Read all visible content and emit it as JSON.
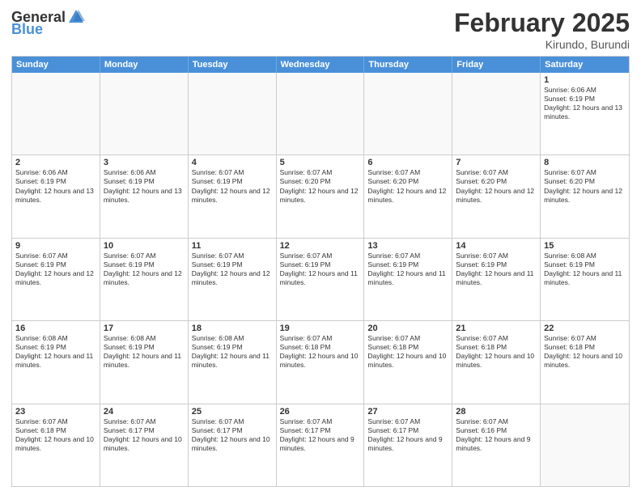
{
  "logo": {
    "general": "General",
    "blue": "Blue"
  },
  "title": {
    "month": "February 2025",
    "location": "Kirundo, Burundi"
  },
  "header": {
    "days": [
      "Sunday",
      "Monday",
      "Tuesday",
      "Wednesday",
      "Thursday",
      "Friday",
      "Saturday"
    ]
  },
  "weeks": [
    {
      "cells": [
        {
          "day": "",
          "info": "",
          "empty": true
        },
        {
          "day": "",
          "info": "",
          "empty": true
        },
        {
          "day": "",
          "info": "",
          "empty": true
        },
        {
          "day": "",
          "info": "",
          "empty": true
        },
        {
          "day": "",
          "info": "",
          "empty": true
        },
        {
          "day": "",
          "info": "",
          "empty": true
        },
        {
          "day": "1",
          "info": "Sunrise: 6:06 AM\nSunset: 6:19 PM\nDaylight: 12 hours and 13 minutes."
        }
      ]
    },
    {
      "cells": [
        {
          "day": "2",
          "info": "Sunrise: 6:06 AM\nSunset: 6:19 PM\nDaylight: 12 hours and 13 minutes."
        },
        {
          "day": "3",
          "info": "Sunrise: 6:06 AM\nSunset: 6:19 PM\nDaylight: 12 hours and 13 minutes."
        },
        {
          "day": "4",
          "info": "Sunrise: 6:07 AM\nSunset: 6:19 PM\nDaylight: 12 hours and 12 minutes."
        },
        {
          "day": "5",
          "info": "Sunrise: 6:07 AM\nSunset: 6:20 PM\nDaylight: 12 hours and 12 minutes."
        },
        {
          "day": "6",
          "info": "Sunrise: 6:07 AM\nSunset: 6:20 PM\nDaylight: 12 hours and 12 minutes."
        },
        {
          "day": "7",
          "info": "Sunrise: 6:07 AM\nSunset: 6:20 PM\nDaylight: 12 hours and 12 minutes."
        },
        {
          "day": "8",
          "info": "Sunrise: 6:07 AM\nSunset: 6:20 PM\nDaylight: 12 hours and 12 minutes."
        }
      ]
    },
    {
      "cells": [
        {
          "day": "9",
          "info": "Sunrise: 6:07 AM\nSunset: 6:19 PM\nDaylight: 12 hours and 12 minutes."
        },
        {
          "day": "10",
          "info": "Sunrise: 6:07 AM\nSunset: 6:19 PM\nDaylight: 12 hours and 12 minutes."
        },
        {
          "day": "11",
          "info": "Sunrise: 6:07 AM\nSunset: 6:19 PM\nDaylight: 12 hours and 12 minutes."
        },
        {
          "day": "12",
          "info": "Sunrise: 6:07 AM\nSunset: 6:19 PM\nDaylight: 12 hours and 11 minutes."
        },
        {
          "day": "13",
          "info": "Sunrise: 6:07 AM\nSunset: 6:19 PM\nDaylight: 12 hours and 11 minutes."
        },
        {
          "day": "14",
          "info": "Sunrise: 6:07 AM\nSunset: 6:19 PM\nDaylight: 12 hours and 11 minutes."
        },
        {
          "day": "15",
          "info": "Sunrise: 6:08 AM\nSunset: 6:19 PM\nDaylight: 12 hours and 11 minutes."
        }
      ]
    },
    {
      "cells": [
        {
          "day": "16",
          "info": "Sunrise: 6:08 AM\nSunset: 6:19 PM\nDaylight: 12 hours and 11 minutes."
        },
        {
          "day": "17",
          "info": "Sunrise: 6:08 AM\nSunset: 6:19 PM\nDaylight: 12 hours and 11 minutes."
        },
        {
          "day": "18",
          "info": "Sunrise: 6:08 AM\nSunset: 6:19 PM\nDaylight: 12 hours and 11 minutes."
        },
        {
          "day": "19",
          "info": "Sunrise: 6:07 AM\nSunset: 6:18 PM\nDaylight: 12 hours and 10 minutes."
        },
        {
          "day": "20",
          "info": "Sunrise: 6:07 AM\nSunset: 6:18 PM\nDaylight: 12 hours and 10 minutes."
        },
        {
          "day": "21",
          "info": "Sunrise: 6:07 AM\nSunset: 6:18 PM\nDaylight: 12 hours and 10 minutes."
        },
        {
          "day": "22",
          "info": "Sunrise: 6:07 AM\nSunset: 6:18 PM\nDaylight: 12 hours and 10 minutes."
        }
      ]
    },
    {
      "cells": [
        {
          "day": "23",
          "info": "Sunrise: 6:07 AM\nSunset: 6:18 PM\nDaylight: 12 hours and 10 minutes."
        },
        {
          "day": "24",
          "info": "Sunrise: 6:07 AM\nSunset: 6:17 PM\nDaylight: 12 hours and 10 minutes."
        },
        {
          "day": "25",
          "info": "Sunrise: 6:07 AM\nSunset: 6:17 PM\nDaylight: 12 hours and 10 minutes."
        },
        {
          "day": "26",
          "info": "Sunrise: 6:07 AM\nSunset: 6:17 PM\nDaylight: 12 hours and 9 minutes."
        },
        {
          "day": "27",
          "info": "Sunrise: 6:07 AM\nSunset: 6:17 PM\nDaylight: 12 hours and 9 minutes."
        },
        {
          "day": "28",
          "info": "Sunrise: 6:07 AM\nSunset: 6:16 PM\nDaylight: 12 hours and 9 minutes."
        },
        {
          "day": "",
          "info": "",
          "empty": true
        }
      ]
    }
  ]
}
